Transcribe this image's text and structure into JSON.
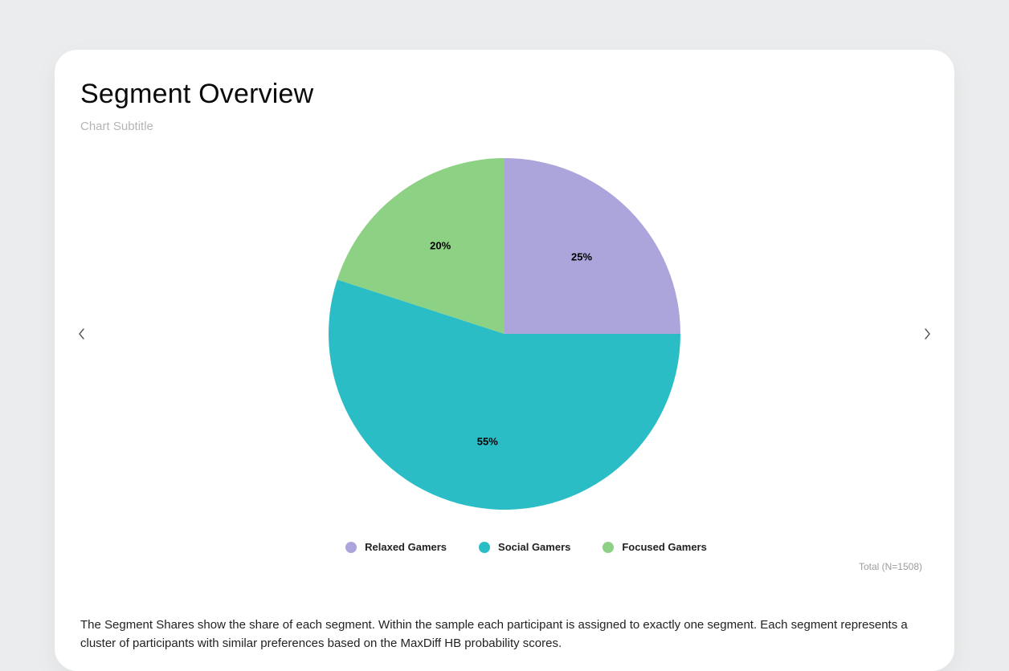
{
  "card": {
    "title": "Segment Overview",
    "subtitle": "Chart Subtitle",
    "total_note": "Total (N=1508)",
    "description": "The Segment Shares show the share of each segment. Within the sample each participant is assigned to exactly one segment. Each segment represents a cluster of participants with similar preferences based on the MaxDiff HB probability scores."
  },
  "legend": {
    "items": [
      {
        "label": "Relaxed Gamers",
        "color": "#aba5dc"
      },
      {
        "label": "Social Gamers",
        "color": "#2bbdc6"
      },
      {
        "label": "Focused Gamers",
        "color": "#8dd184"
      }
    ]
  },
  "chart_data": {
    "type": "pie",
    "title": "Segment Overview",
    "categories": [
      "Relaxed Gamers",
      "Social Gamers",
      "Focused Gamers"
    ],
    "values": [
      25,
      55,
      20
    ],
    "value_suffix": "%",
    "colors": [
      "#aba5dc",
      "#2bbdc6",
      "#8dd184"
    ],
    "labels": [
      "25%",
      "55%",
      "20%"
    ]
  }
}
